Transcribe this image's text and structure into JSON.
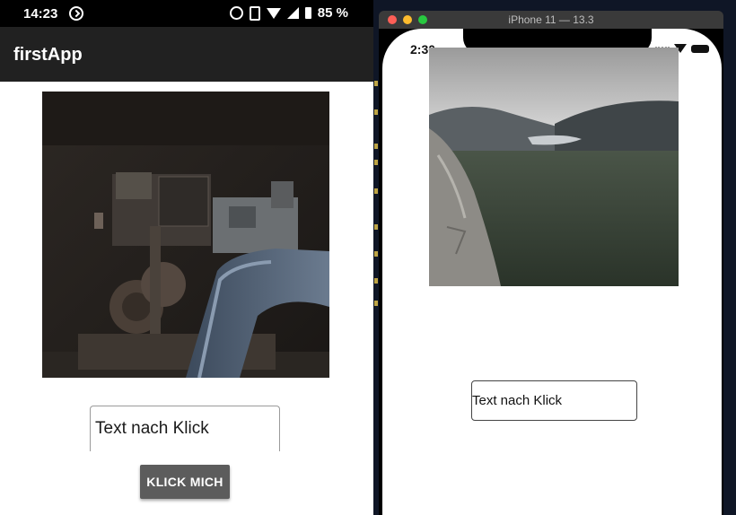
{
  "android": {
    "status_bar": {
      "time": "14:23",
      "battery_percent": "85 %"
    },
    "app_bar": {
      "title": "firstApp"
    },
    "text_field": {
      "value": "Text nach Klick"
    },
    "button": {
      "label": "KLICK MICH"
    }
  },
  "ios_simulator": {
    "window_title": "iPhone 11 — 13.3",
    "status_bar": {
      "time": "2:30"
    },
    "text_field": {
      "value": "Text nach Klick"
    }
  }
}
